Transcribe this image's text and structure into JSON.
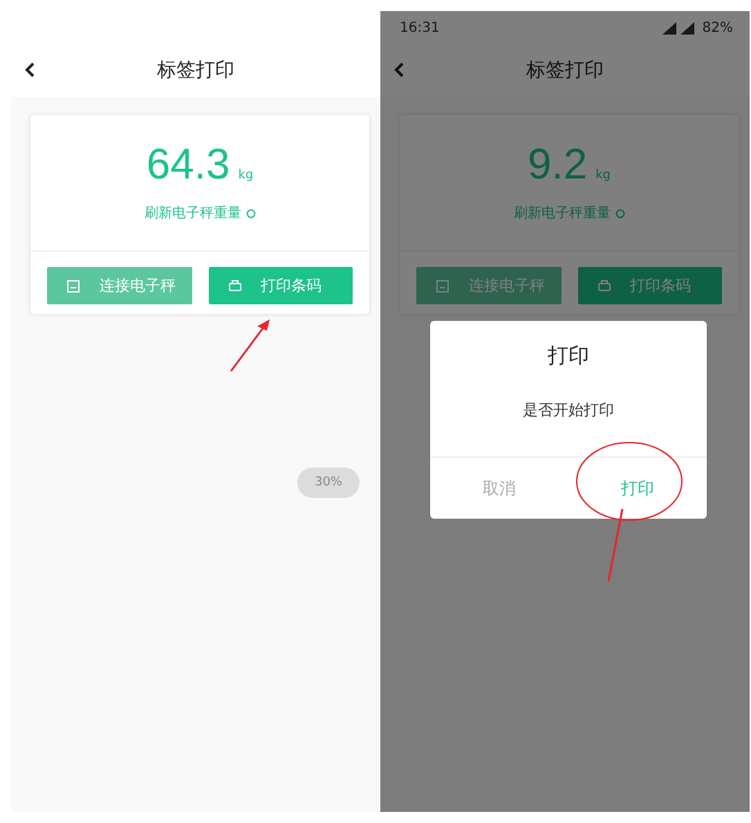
{
  "screens": [
    {
      "kind": "plain",
      "header": {
        "title": "标签打印"
      },
      "weight": {
        "value": "64.3",
        "unit": "kg"
      },
      "refresh_link": "刷新电子秤重量",
      "buttons": [
        {
          "label": "连接电子秤",
          "disabled": true
        },
        {
          "label": "打印条码",
          "disabled": false
        }
      ],
      "toast": "30%"
    },
    {
      "kind": "dialog",
      "status_bar": {
        "time": "16:31",
        "battery": "82%"
      },
      "header": {
        "title": "标签打印"
      },
      "weight": {
        "value": "9.2",
        "unit": "kg"
      },
      "refresh_link": "刷新电子秤重量",
      "buttons": [
        {
          "label": "连接电子秤",
          "disabled": true
        },
        {
          "label": "打印条码",
          "disabled": false
        }
      ],
      "dialog": {
        "title": "打印",
        "message": "是否开始打印",
        "buttons": [
          {
            "label": "取消",
            "primary": false
          },
          {
            "label": "打印",
            "primary": true
          }
        ]
      }
    }
  ]
}
